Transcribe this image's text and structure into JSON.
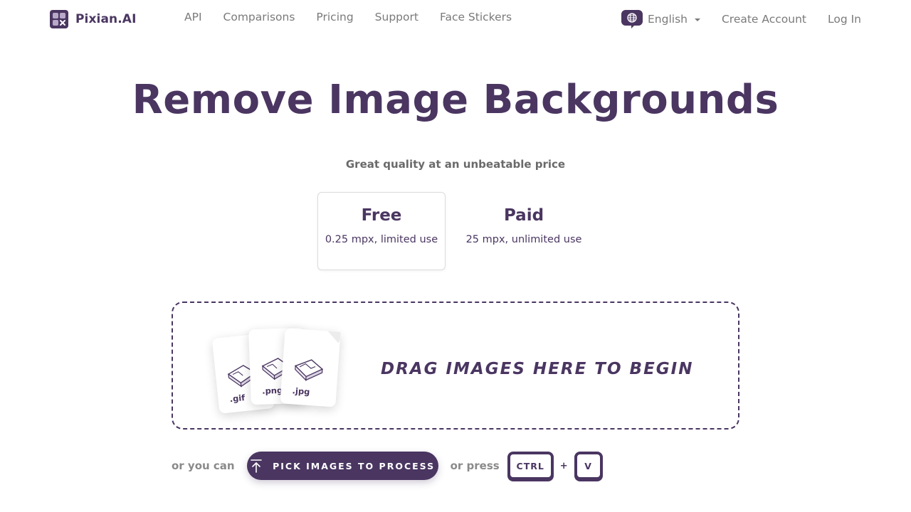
{
  "nav": {
    "brand": "Pixian.AI",
    "links": [
      "API",
      "Comparisons",
      "Pricing",
      "Support",
      "Face Stickers"
    ],
    "language": "English",
    "create_account": "Create Account",
    "log_in": "Log In"
  },
  "hero": {
    "title": "Remove Image Backgrounds",
    "subtitle": "Great quality at an unbeatable price"
  },
  "plans": [
    {
      "name": "Free",
      "desc": "0.25 mpx, limited use",
      "selected": true
    },
    {
      "name": "Paid",
      "desc": "25 mpx, unlimited use",
      "selected": false
    }
  ],
  "dropzone": {
    "text": "DRAG IMAGES HERE TO BEGIN",
    "file_types": [
      ".gif",
      ".png",
      ".jpg"
    ]
  },
  "actions": {
    "or_you_can": "or you can",
    "pick_button": "PICK IMAGES TO PROCESS",
    "or_press": "or press",
    "key_ctrl": "CTRL",
    "plus": "+",
    "key_v": "V"
  },
  "colors": {
    "brand": "#4a3661",
    "muted_text": "#7a7a7a",
    "background": "#ffffff"
  }
}
